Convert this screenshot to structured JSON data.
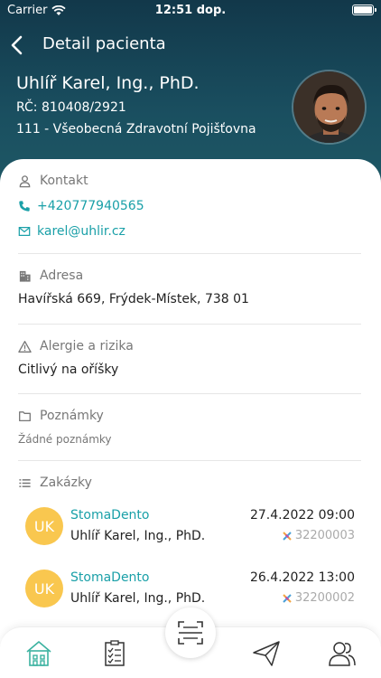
{
  "status_bar": {
    "carrier": "Carrier",
    "time": "12:51 dop."
  },
  "nav": {
    "title": "Detail pacienta"
  },
  "patient": {
    "name": "Uhlíř Karel, Ing., PhD.",
    "rc": "RČ: 810408/2921",
    "insurer": "111 - Všeobecná Zdravotní Pojišťovna"
  },
  "contact": {
    "heading": "Kontakt",
    "phone": "+420777940565",
    "email": "karel@uhlir.cz"
  },
  "address": {
    "heading": "Adresa",
    "value": "Havířská 669, Frýdek-Místek, 738 01"
  },
  "allergies": {
    "heading": "Alergie a rizika",
    "value": "Citlivý na oříšky"
  },
  "notes": {
    "heading": "Poznámky",
    "value": "Žádné poznámky"
  },
  "orders": {
    "heading": "Zakázky",
    "items": [
      {
        "initials": "UK",
        "clinic": "StomaDento",
        "patient": "Uhlíř Karel, Ing., PhD.",
        "datetime": "27.4.2022 09:00",
        "code": "32200003"
      },
      {
        "initials": "UK",
        "clinic": "StomaDento",
        "patient": "Uhlíř Karel, Ing., PhD.",
        "datetime": "26.4.2022 13:00",
        "code": "32200002"
      }
    ]
  },
  "icons": {
    "back": "chevron-left-icon",
    "contact": "person-icon",
    "phone": "phone-icon",
    "email": "mail-icon",
    "address": "building-icon",
    "allergies": "warning-icon",
    "notes": "folder-icon",
    "orders": "list-icon",
    "tab_home": "home-icon",
    "tab_tasks": "checklist-icon",
    "tab_scan": "scan-icon",
    "tab_send": "paper-plane-icon",
    "tab_people": "people-icon"
  },
  "colors": {
    "header": "#1a4f60",
    "accent": "#1aa0a8",
    "avatar_badge": "#f9c74f",
    "muted": "#777777"
  }
}
